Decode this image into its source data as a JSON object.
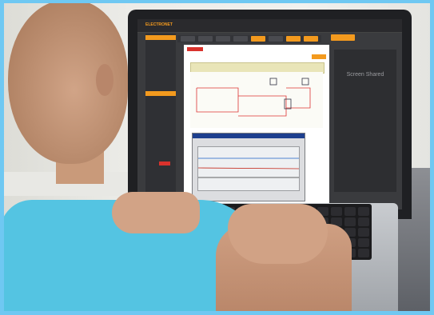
{
  "app": {
    "logo_text": "ELECTRONET",
    "right_panel_label": "Screen Shared"
  },
  "colors": {
    "accent_orange": "#f39a1e",
    "accent_red": "#d9322c",
    "shirt_blue": "#54c4e2",
    "frame_blue": "#6fc8f2"
  }
}
